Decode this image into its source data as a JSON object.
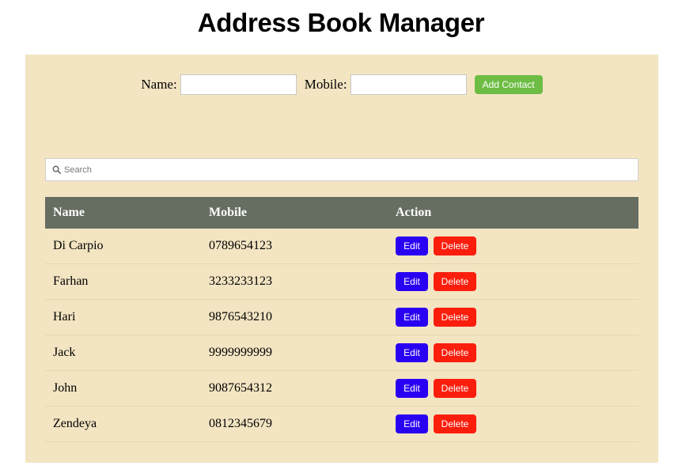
{
  "header": {
    "title": "Address Book Manager"
  },
  "form": {
    "name_label": "Name:",
    "name_value": "",
    "mobile_label": "Mobile:",
    "mobile_value": "",
    "add_button": "Add Contact"
  },
  "search": {
    "placeholder": "Search",
    "value": ""
  },
  "table": {
    "columns": [
      "Name",
      "Mobile",
      "Action"
    ],
    "rows": [
      {
        "name": "Di Carpio",
        "mobile": "0789654123"
      },
      {
        "name": "Farhan",
        "mobile": "3233233123"
      },
      {
        "name": "Hari",
        "mobile": "9876543210"
      },
      {
        "name": "Jack",
        "mobile": "9999999999"
      },
      {
        "name": "John",
        "mobile": "9087654312"
      },
      {
        "name": "Zendeya",
        "mobile": "0812345679"
      }
    ],
    "edit_label": "Edit",
    "delete_label": "Delete"
  },
  "colors": {
    "panel_bg": "#f3e4c2",
    "header_bg": "#666e62",
    "add_button": "#6dbd45",
    "edit_button": "#2a00f2",
    "delete_button": "#fb1e0d"
  },
  "icons": {
    "search": "search-icon"
  }
}
